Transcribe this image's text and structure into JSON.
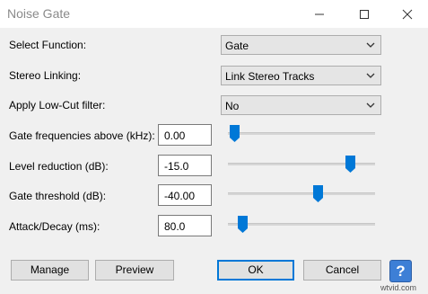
{
  "window": {
    "title": "Noise Gate"
  },
  "titlebar_icons": [
    "minimize-icon",
    "maximize-icon",
    "close-icon"
  ],
  "fields": {
    "select_function": {
      "label": "Select Function:",
      "value": "Gate"
    },
    "stereo_linking": {
      "label": "Stereo Linking:",
      "value": "Link Stereo Tracks"
    },
    "low_cut": {
      "label": "Apply Low-Cut filter:",
      "value": "No"
    },
    "gate_freq": {
      "label": "Gate frequencies above (kHz):",
      "value": "0.00",
      "slider_fraction": 0.04
    },
    "level_reduction": {
      "label": "Level reduction (dB):",
      "value": "-15.0",
      "slider_fraction": 0.83
    },
    "gate_threshold": {
      "label": "Gate threshold (dB):",
      "value": "-40.00",
      "slider_fraction": 0.61
    },
    "attack_decay": {
      "label": "Attack/Decay (ms):",
      "value": "80.0",
      "slider_fraction": 0.1
    }
  },
  "buttons": {
    "manage": "Manage",
    "preview": "Preview",
    "ok": "OK",
    "cancel": "Cancel",
    "help": "?"
  },
  "watermark": "wtvid.com",
  "colors": {
    "accent": "#0078d7",
    "help_button": "#3d7fd6"
  }
}
